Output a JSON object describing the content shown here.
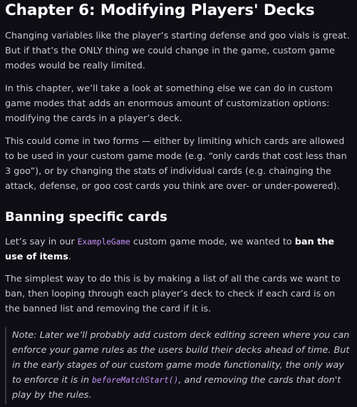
{
  "chapter_title": "Chapter 6: Modifying Players' Decks",
  "intro_1": "Changing variables like the player’s starting defense and goo vials is great. But if that’s the ONLY thing we could change in the game, custom game modes would be really limited.",
  "intro_2": "In this chapter, we’ll take a look at something else we can do in custom game modes that adds an enormous amount of customization options: modifying the cards in a player’s deck.",
  "intro_3": "This could come in two forms — either by limiting which cards are allowed to be used in your custom game mode (e.g. “only cards that cost less than 3 goo”), or by changing the stats of individual cards (e.g. chainging the attack, defense, or goo cost cards you think are over- or under-powered).",
  "section_title": "Banning specific cards",
  "banning": {
    "pre": "Let’s say in our ",
    "code": "ExampleGame",
    "mid": " custom game mode, we wanted to ",
    "strong": "ban the use of items",
    "post": "."
  },
  "simplest": "The simplest way to do this is by making a list of all the cards we want to ban, then looping through each player’s deck to check if each card is on the banned list and removing the card if it is.",
  "note": {
    "pre": "Note: Later we’ll probably add custom deck editing screen where you can enforce your game rules as the users build their decks ahead of time. But in the early stages of our custom game mode functionality, the only way to enforce it is in ",
    "code": "beforeMatchStart()",
    "post": ", and removing the cards that don't play by the rules."
  }
}
